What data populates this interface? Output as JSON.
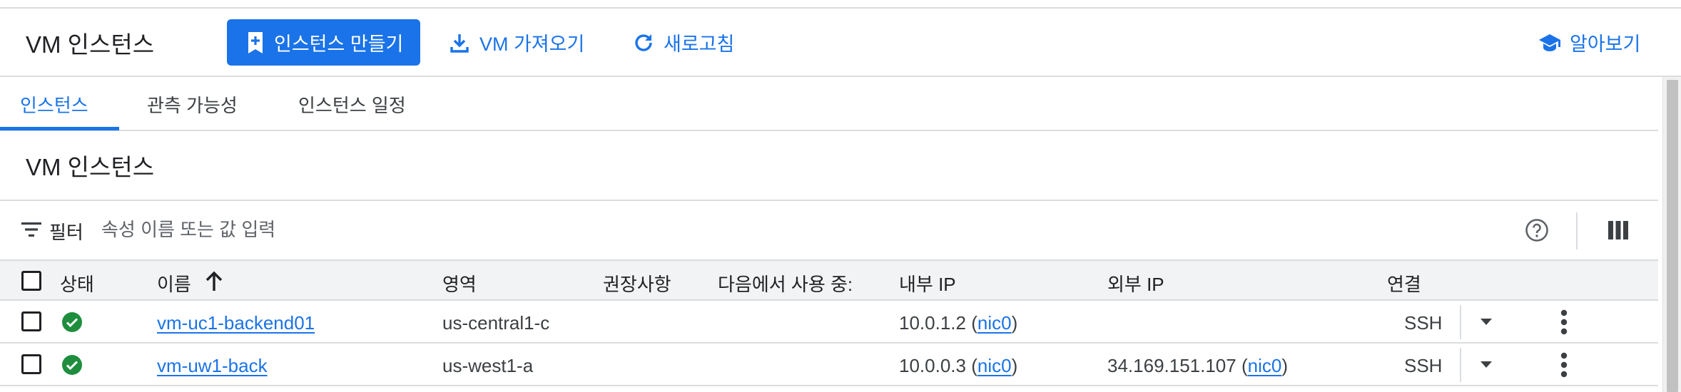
{
  "header": {
    "title": "VM 인스턴스",
    "create_label": "인스턴스 만들기",
    "import_label": "VM 가져오기",
    "refresh_label": "새로고침",
    "learn_label": "알아보기"
  },
  "tabs": [
    {
      "label": "인스턴스",
      "active": true
    },
    {
      "label": "관측 가능성",
      "active": false
    },
    {
      "label": "인스턴스 일정",
      "active": false
    }
  ],
  "section": {
    "title": "VM 인스턴스"
  },
  "filter": {
    "label": "필터",
    "placeholder": "속성 이름 또는 값 입력",
    "icons": [
      "filter-icon",
      "help-icon",
      "columns-icon"
    ]
  },
  "table": {
    "columns": {
      "status": "상태",
      "name": "이름",
      "zone": "영역",
      "recommendation": "권장사항",
      "in_use_by": "다음에서 사용 중:",
      "internal_ip": "내부 IP",
      "external_ip": "외부 IP",
      "connect": "연결"
    },
    "sort": {
      "column": "name",
      "direction": "ascending"
    },
    "rows": [
      {
        "status": "running",
        "name": "vm-uc1-backend01",
        "zone": "us-central1-c",
        "recommendation": "",
        "in_use_by": "",
        "internal_ip": "10.0.1.2",
        "internal_nic": "nic0",
        "external_ip": "",
        "external_nic": "",
        "connect": "SSH"
      },
      {
        "status": "running",
        "name": "vm-uw1-back",
        "zone": "us-west1-a",
        "recommendation": "",
        "in_use_by": "",
        "internal_ip": "10.0.0.3",
        "internal_nic": "nic0",
        "external_ip": "34.169.151.107",
        "external_nic": "nic0",
        "connect": "SSH"
      }
    ]
  },
  "colors": {
    "primary": "#1a73e8",
    "status_ok": "#1e8e3e",
    "header_bg": "#f1f3f4",
    "divider": "#dadce0"
  }
}
